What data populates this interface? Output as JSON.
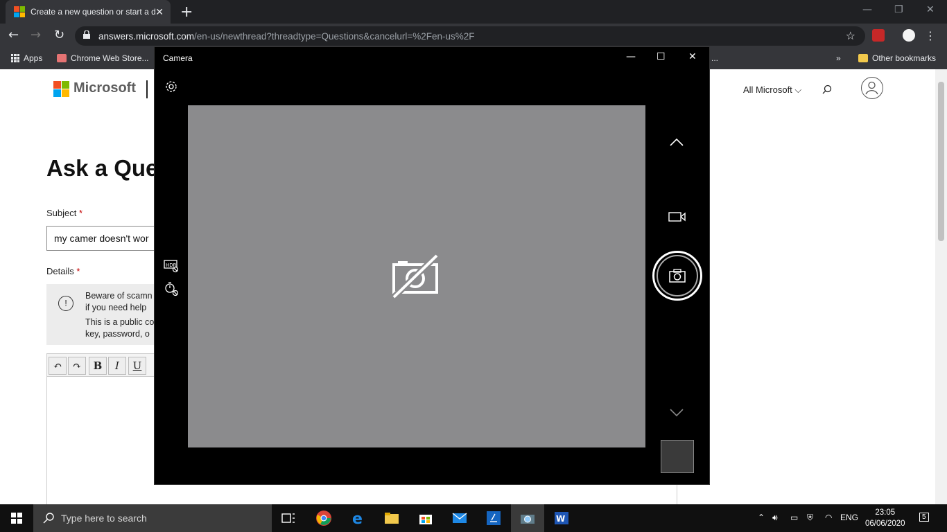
{
  "browser": {
    "tab_title": "Create a new question or start a d",
    "new_tab": "+",
    "url_host": "answers.microsoft.com",
    "url_path": "/en-us/newthread?threadtype=Questions&cancelurl=%2Fen-us%2F",
    "bookmarks": {
      "apps": "Apps",
      "chrome_web_store": "Chrome Web Store...",
      "overflow_trunc": "...",
      "more": "»",
      "other": "Other bookmarks"
    },
    "icons": [
      "back-icon",
      "forward-icon",
      "reload-icon",
      "lock-icon",
      "star-icon",
      "menu-dots-icon"
    ]
  },
  "page": {
    "brand": "Microsoft",
    "all_microsoft": "All Microsoft",
    "heading": "Ask a Que",
    "subject_label": "Subject",
    "required_mark": "*",
    "subject_value": "my camer doesn't wor",
    "details_label": "Details",
    "notice_line1": "Beware of scamn",
    "notice_line2": "if you need help",
    "notice_line3": "This is a public co",
    "notice_line4": "key, password, o",
    "notice_icon": "!",
    "editor_buttons": [
      "↶",
      "↷",
      "B",
      "I",
      "U"
    ]
  },
  "camera": {
    "title": "Camera",
    "minimize": "—",
    "maximize": "☐",
    "close": "✕",
    "icons": [
      "settings-icon",
      "hdr-off-icon",
      "timer-off-icon",
      "no-camera-icon",
      "chevron-up-icon",
      "video-mode-icon",
      "photo-capture-icon",
      "chevron-down-icon"
    ]
  },
  "taskbar": {
    "search_placeholder": "Type here to search",
    "language": "ENG",
    "time": "23:05",
    "date": "06/06/2020",
    "notifications": "5"
  },
  "colors": {
    "chrome_dark": "#202124",
    "chrome_toolbar": "#35363a",
    "camera_viewport": "#8b8b8d",
    "taskbar": "#101010"
  }
}
